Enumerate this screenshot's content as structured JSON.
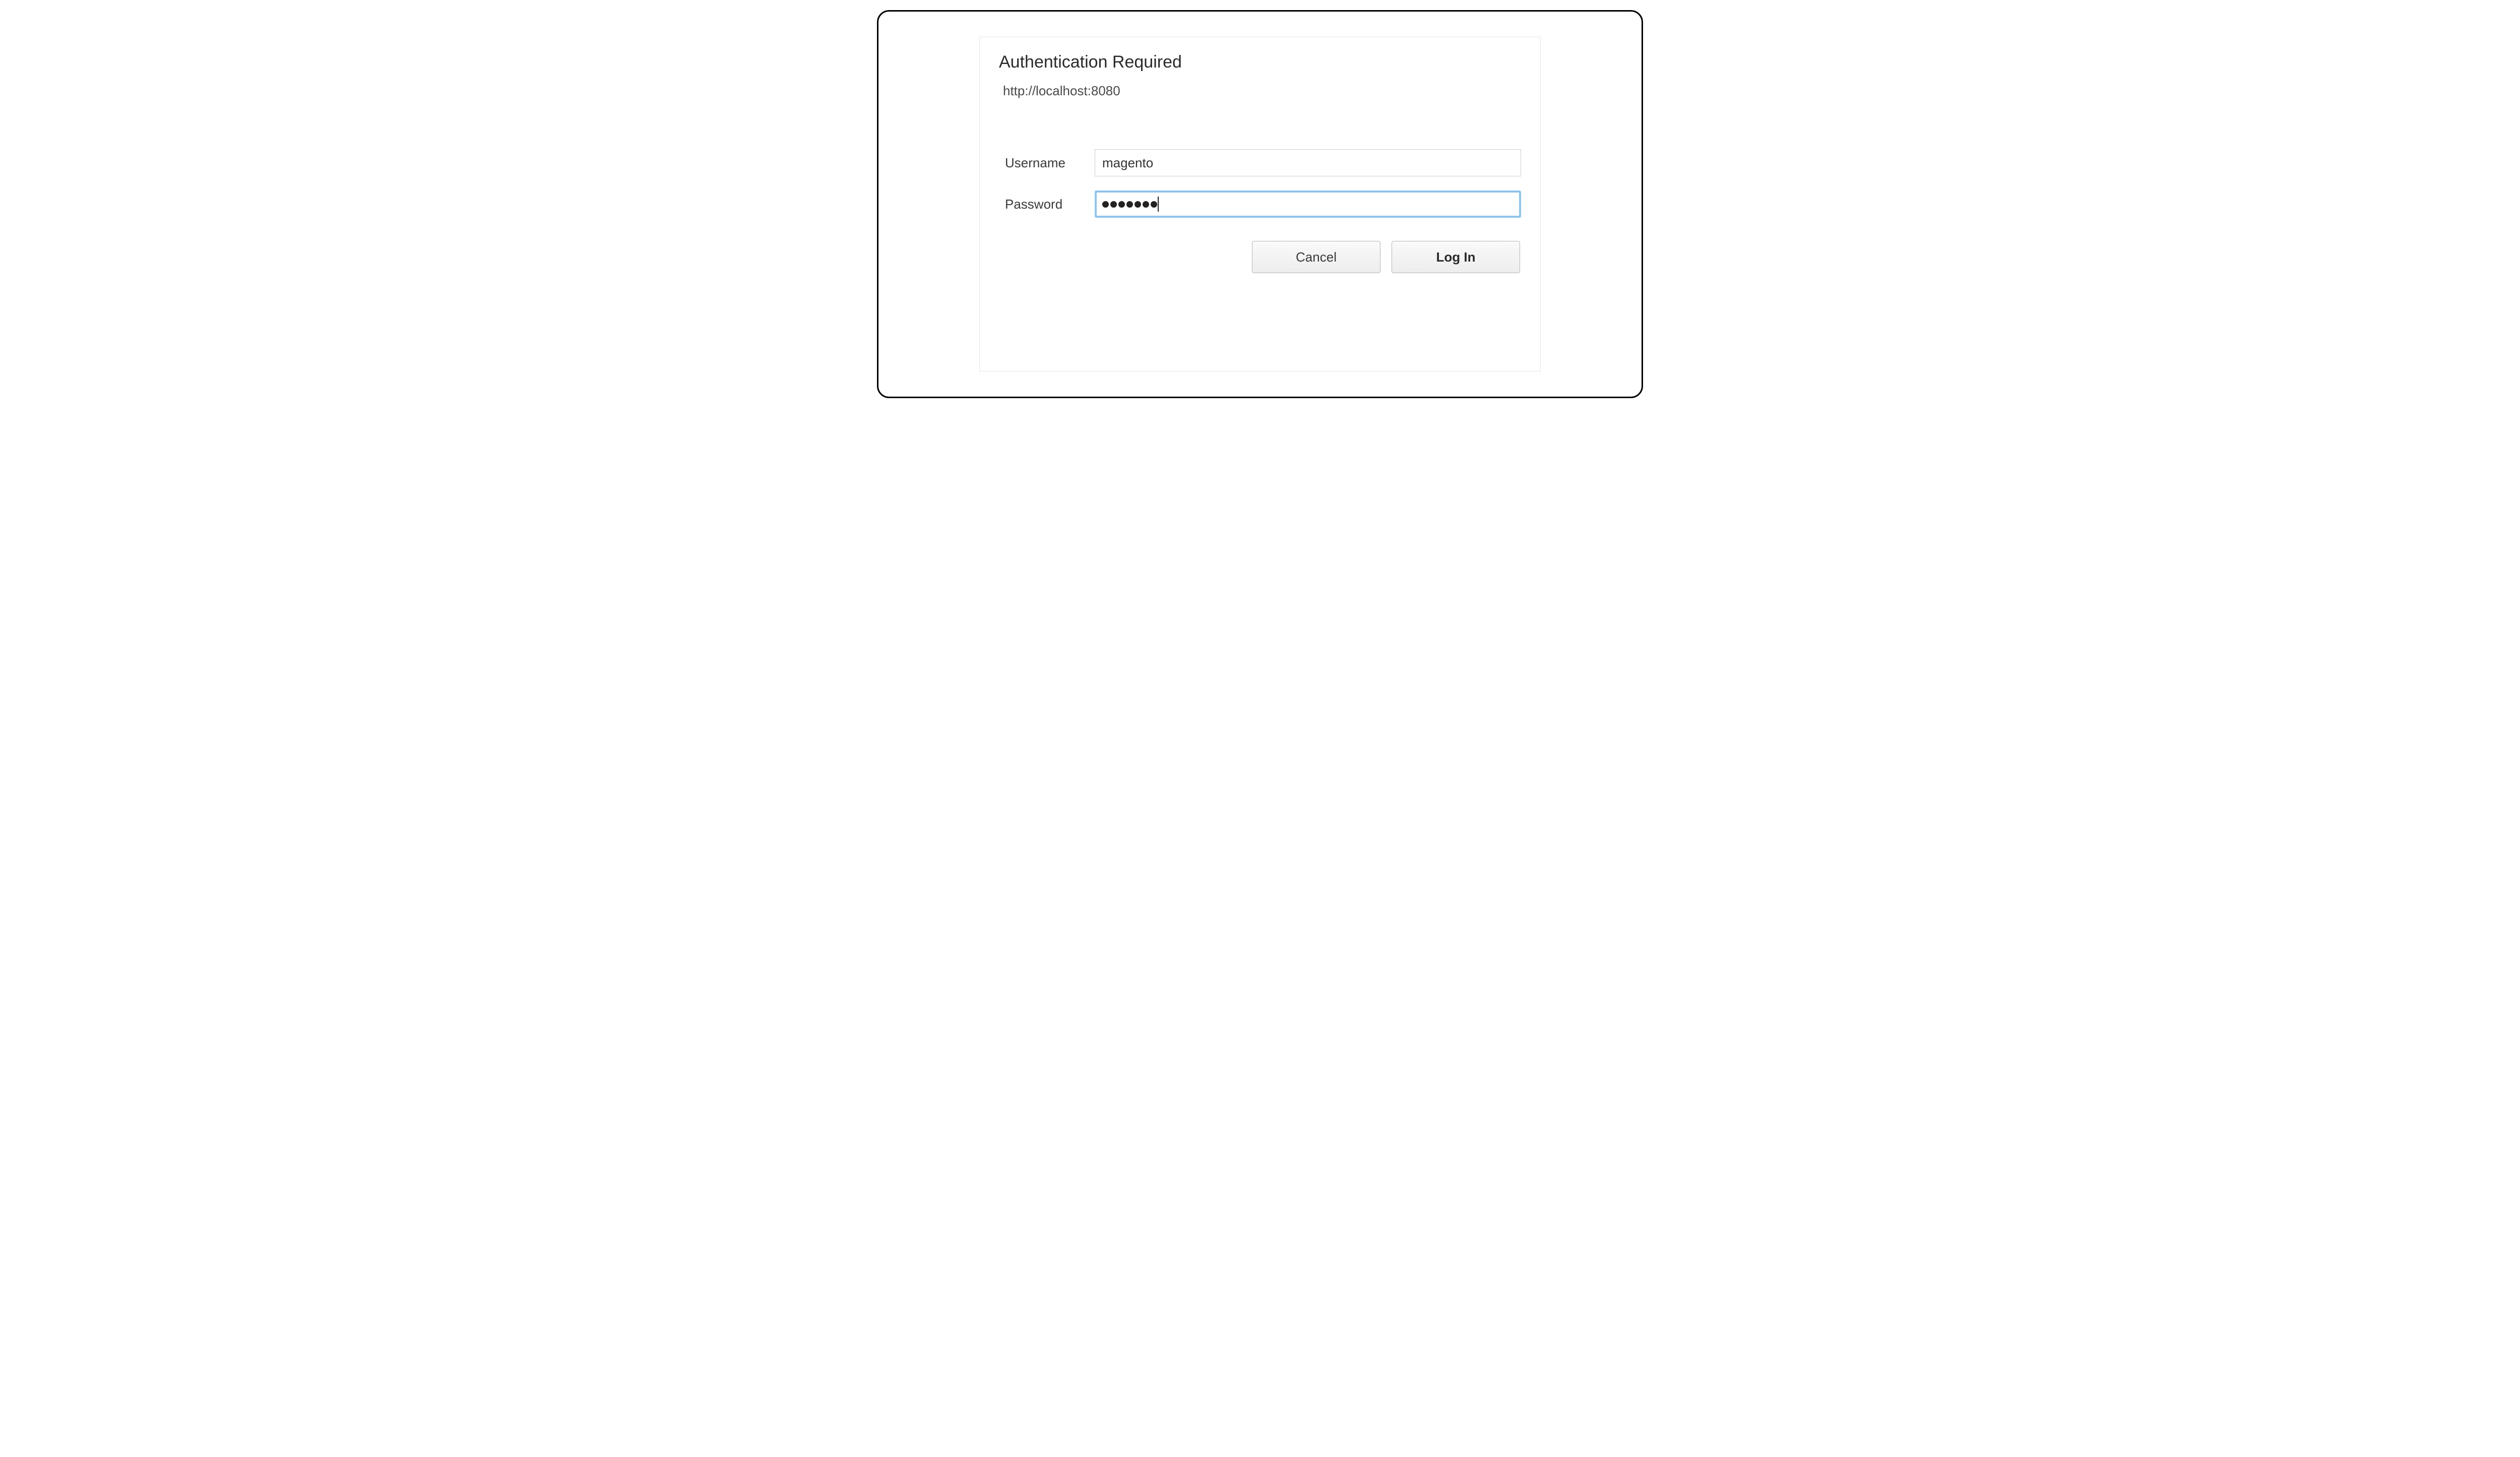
{
  "dialog": {
    "title": "Authentication Required",
    "url": "http://localhost:8080",
    "fields": {
      "username": {
        "label": "Username",
        "value": "magento"
      },
      "password": {
        "label": "Password",
        "dot_count": 7
      }
    },
    "buttons": {
      "cancel": "Cancel",
      "login": "Log In"
    }
  }
}
